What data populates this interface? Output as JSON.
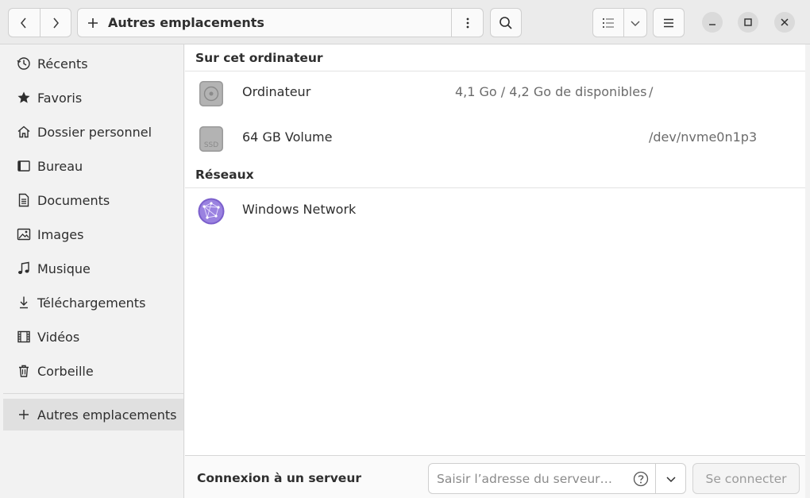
{
  "header": {
    "location_label": "Autres emplacements"
  },
  "sidebar": {
    "items": [
      {
        "label": "Récents",
        "icon": "clock-icon"
      },
      {
        "label": "Favoris",
        "icon": "star-icon"
      },
      {
        "label": "Dossier personnel",
        "icon": "home-icon"
      },
      {
        "label": "Bureau",
        "icon": "desktop-icon"
      },
      {
        "label": "Documents",
        "icon": "document-icon"
      },
      {
        "label": "Images",
        "icon": "image-icon"
      },
      {
        "label": "Musique",
        "icon": "music-icon"
      },
      {
        "label": "Téléchargements",
        "icon": "download-icon"
      },
      {
        "label": "Vidéos",
        "icon": "film-icon"
      },
      {
        "label": "Corbeille",
        "icon": "trash-icon"
      }
    ],
    "other_locations": {
      "label": "Autres emplacements",
      "icon": "plus-icon"
    }
  },
  "main": {
    "computer_section": {
      "title": "Sur cet ordinateur",
      "places": [
        {
          "name": "Ordinateur",
          "space": "4,1 Go / 4,2 Go de disponibles",
          "path": "/",
          "icon": "hard-disk-icon"
        },
        {
          "name": "64 GB Volume",
          "space": "",
          "path": "/dev/nvme0n1p3",
          "icon": "ssd-icon"
        }
      ]
    },
    "network_section": {
      "title": "Réseaux",
      "places": [
        {
          "name": "Windows Network",
          "icon": "network-globe-icon"
        }
      ]
    }
  },
  "footer": {
    "connect_label": "Connexion à un serveur",
    "server_placeholder": "Saisir l’adresse du serveur…",
    "connect_button": "Se connecter"
  },
  "colors": {
    "accent_network": "#8a6fd6",
    "sidebar_bg": "#f2f2f2",
    "header_bg": "#ebebeb"
  }
}
